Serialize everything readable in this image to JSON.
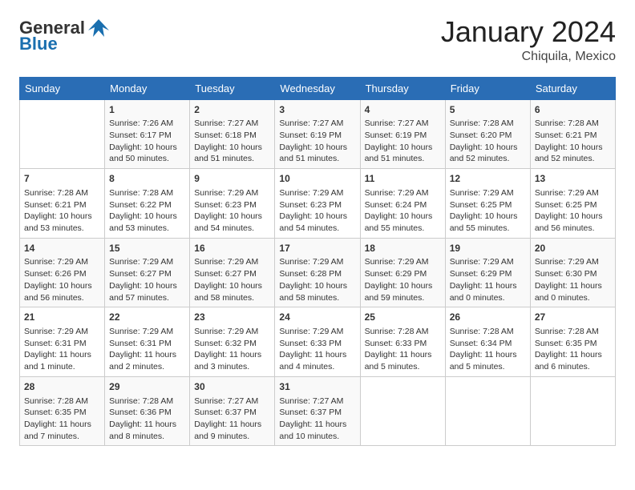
{
  "header": {
    "logo_general": "General",
    "logo_blue": "Blue",
    "month_title": "January 2024",
    "location": "Chiquila, Mexico"
  },
  "days_of_week": [
    "Sunday",
    "Monday",
    "Tuesday",
    "Wednesday",
    "Thursday",
    "Friday",
    "Saturday"
  ],
  "weeks": [
    [
      {
        "day": "",
        "info": ""
      },
      {
        "day": "1",
        "info": "Sunrise: 7:26 AM\nSunset: 6:17 PM\nDaylight: 10 hours\nand 50 minutes."
      },
      {
        "day": "2",
        "info": "Sunrise: 7:27 AM\nSunset: 6:18 PM\nDaylight: 10 hours\nand 51 minutes."
      },
      {
        "day": "3",
        "info": "Sunrise: 7:27 AM\nSunset: 6:19 PM\nDaylight: 10 hours\nand 51 minutes."
      },
      {
        "day": "4",
        "info": "Sunrise: 7:27 AM\nSunset: 6:19 PM\nDaylight: 10 hours\nand 51 minutes."
      },
      {
        "day": "5",
        "info": "Sunrise: 7:28 AM\nSunset: 6:20 PM\nDaylight: 10 hours\nand 52 minutes."
      },
      {
        "day": "6",
        "info": "Sunrise: 7:28 AM\nSunset: 6:21 PM\nDaylight: 10 hours\nand 52 minutes."
      }
    ],
    [
      {
        "day": "7",
        "info": "Sunrise: 7:28 AM\nSunset: 6:21 PM\nDaylight: 10 hours\nand 53 minutes."
      },
      {
        "day": "8",
        "info": "Sunrise: 7:28 AM\nSunset: 6:22 PM\nDaylight: 10 hours\nand 53 minutes."
      },
      {
        "day": "9",
        "info": "Sunrise: 7:29 AM\nSunset: 6:23 PM\nDaylight: 10 hours\nand 54 minutes."
      },
      {
        "day": "10",
        "info": "Sunrise: 7:29 AM\nSunset: 6:23 PM\nDaylight: 10 hours\nand 54 minutes."
      },
      {
        "day": "11",
        "info": "Sunrise: 7:29 AM\nSunset: 6:24 PM\nDaylight: 10 hours\nand 55 minutes."
      },
      {
        "day": "12",
        "info": "Sunrise: 7:29 AM\nSunset: 6:25 PM\nDaylight: 10 hours\nand 55 minutes."
      },
      {
        "day": "13",
        "info": "Sunrise: 7:29 AM\nSunset: 6:25 PM\nDaylight: 10 hours\nand 56 minutes."
      }
    ],
    [
      {
        "day": "14",
        "info": "Sunrise: 7:29 AM\nSunset: 6:26 PM\nDaylight: 10 hours\nand 56 minutes."
      },
      {
        "day": "15",
        "info": "Sunrise: 7:29 AM\nSunset: 6:27 PM\nDaylight: 10 hours\nand 57 minutes."
      },
      {
        "day": "16",
        "info": "Sunrise: 7:29 AM\nSunset: 6:27 PM\nDaylight: 10 hours\nand 58 minutes."
      },
      {
        "day": "17",
        "info": "Sunrise: 7:29 AM\nSunset: 6:28 PM\nDaylight: 10 hours\nand 58 minutes."
      },
      {
        "day": "18",
        "info": "Sunrise: 7:29 AM\nSunset: 6:29 PM\nDaylight: 10 hours\nand 59 minutes."
      },
      {
        "day": "19",
        "info": "Sunrise: 7:29 AM\nSunset: 6:29 PM\nDaylight: 11 hours\nand 0 minutes."
      },
      {
        "day": "20",
        "info": "Sunrise: 7:29 AM\nSunset: 6:30 PM\nDaylight: 11 hours\nand 0 minutes."
      }
    ],
    [
      {
        "day": "21",
        "info": "Sunrise: 7:29 AM\nSunset: 6:31 PM\nDaylight: 11 hours\nand 1 minute."
      },
      {
        "day": "22",
        "info": "Sunrise: 7:29 AM\nSunset: 6:31 PM\nDaylight: 11 hours\nand 2 minutes."
      },
      {
        "day": "23",
        "info": "Sunrise: 7:29 AM\nSunset: 6:32 PM\nDaylight: 11 hours\nand 3 minutes."
      },
      {
        "day": "24",
        "info": "Sunrise: 7:29 AM\nSunset: 6:33 PM\nDaylight: 11 hours\nand 4 minutes."
      },
      {
        "day": "25",
        "info": "Sunrise: 7:28 AM\nSunset: 6:33 PM\nDaylight: 11 hours\nand 5 minutes."
      },
      {
        "day": "26",
        "info": "Sunrise: 7:28 AM\nSunset: 6:34 PM\nDaylight: 11 hours\nand 5 minutes."
      },
      {
        "day": "27",
        "info": "Sunrise: 7:28 AM\nSunset: 6:35 PM\nDaylight: 11 hours\nand 6 minutes."
      }
    ],
    [
      {
        "day": "28",
        "info": "Sunrise: 7:28 AM\nSunset: 6:35 PM\nDaylight: 11 hours\nand 7 minutes."
      },
      {
        "day": "29",
        "info": "Sunrise: 7:28 AM\nSunset: 6:36 PM\nDaylight: 11 hours\nand 8 minutes."
      },
      {
        "day": "30",
        "info": "Sunrise: 7:27 AM\nSunset: 6:37 PM\nDaylight: 11 hours\nand 9 minutes."
      },
      {
        "day": "31",
        "info": "Sunrise: 7:27 AM\nSunset: 6:37 PM\nDaylight: 11 hours\nand 10 minutes."
      },
      {
        "day": "",
        "info": ""
      },
      {
        "day": "",
        "info": ""
      },
      {
        "day": "",
        "info": ""
      }
    ]
  ]
}
